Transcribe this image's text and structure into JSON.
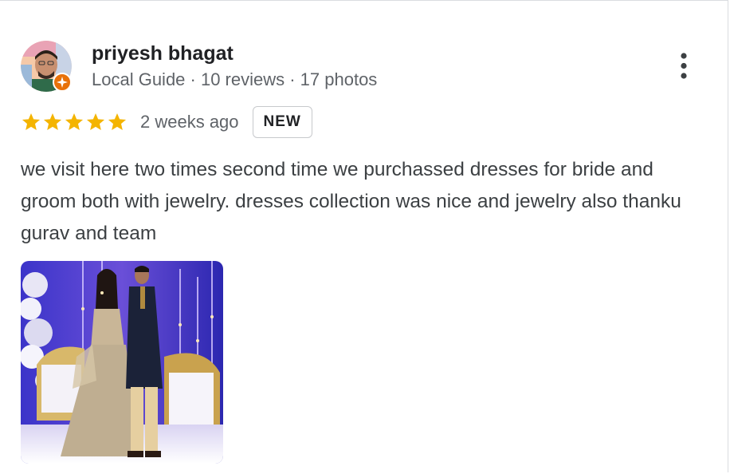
{
  "review": {
    "author": {
      "name": "priyesh bhagat",
      "meta": "Local Guide · 10 reviews · 17 photos"
    },
    "rating": 5,
    "time": "2 weeks ago",
    "badge": "NEW",
    "text": "we visit here two times second time we purchassed dresses for bride and groom both with jewelry. dresses collection was nice and jewelry also thanku gurav and team",
    "photo_count": 1
  },
  "colors": {
    "star": "#f4b400",
    "guide_badge": "#e8710a",
    "text": "#202124",
    "secondary": "#5f6368"
  },
  "icons": {
    "more": "more-vert-icon",
    "star": "star-icon",
    "guide": "local-guide-badge-icon"
  }
}
